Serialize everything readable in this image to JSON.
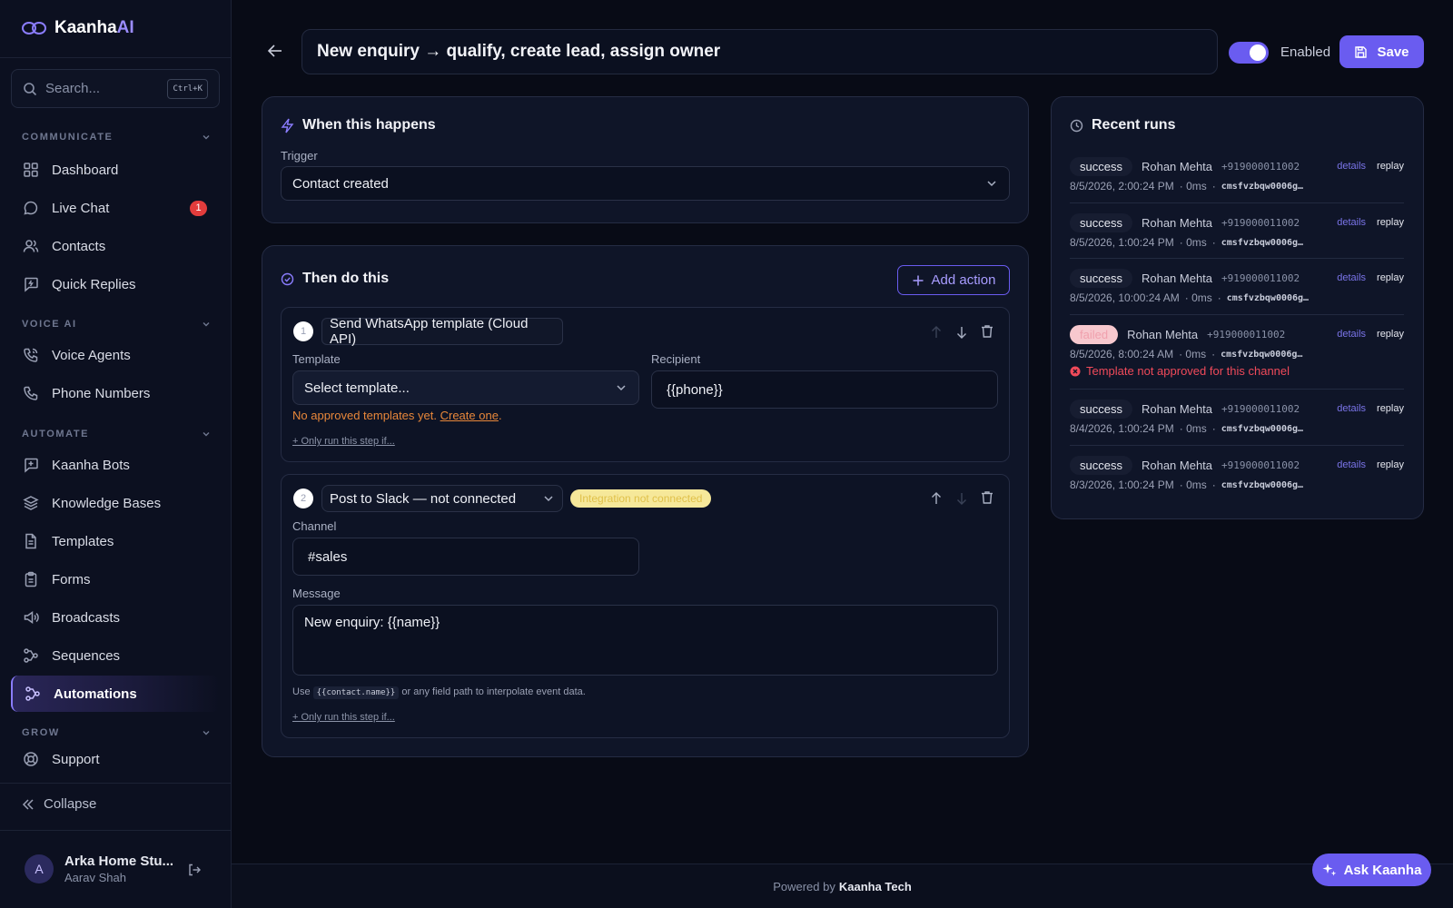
{
  "brand": {
    "name_main": "Kaanha",
    "name_accent": "AI"
  },
  "search": {
    "placeholder": "Search...",
    "shortcut": "Ctrl+K"
  },
  "sidebar": {
    "sections": {
      "communicate": "COMMUNICATE",
      "voice_ai": "VOICE AI",
      "automate": "AUTOMATE",
      "grow": "GROW"
    },
    "items": {
      "dashboard": "Dashboard",
      "live_chat": "Live Chat",
      "live_chat_badge": "1",
      "contacts": "Contacts",
      "quick_replies": "Quick Replies",
      "voice_agents": "Voice Agents",
      "phone_numbers": "Phone Numbers",
      "kaanha_bots": "Kaanha Bots",
      "knowledge_bases": "Knowledge Bases",
      "templates": "Templates",
      "forms": "Forms",
      "broadcasts": "Broadcasts",
      "sequences": "Sequences",
      "automations": "Automations",
      "support": "Support"
    },
    "collapse": "Collapse"
  },
  "user": {
    "avatar_initial": "A",
    "org": "Arka Home Stu...",
    "name": "Aarav Shah"
  },
  "header": {
    "title": "New enquiry → qualify, create lead, assign owner",
    "enabled_label": "Enabled",
    "enabled": true,
    "save_label": "Save"
  },
  "trigger_card": {
    "title": "When this happens",
    "trigger_label": "Trigger",
    "trigger_value": "Contact created"
  },
  "actions_card": {
    "title": "Then do this",
    "add_action": "Add action",
    "step1": {
      "number": "1",
      "name": "Send WhatsApp template (Cloud API)",
      "template_label": "Template",
      "template_value": "Select template...",
      "recipient_label": "Recipient",
      "recipient_value": "{{phone}}",
      "warning_text": "No approved templates yet.",
      "warning_link": "Create one",
      "warning_end": ".",
      "condition": "+ Only run this step if..."
    },
    "step2": {
      "number": "2",
      "name": "Post to Slack — not connected",
      "badge": "Integration not connected",
      "channel_label": "Channel",
      "channel_value": "#sales",
      "message_label": "Message",
      "message_value": "New enquiry: {{name}}",
      "hint_pre": "Use",
      "hint_code": "{{contact.name}}",
      "hint_post": "or any field path to interpolate event data.",
      "condition": "+ Only run this step if..."
    }
  },
  "runs_card": {
    "title": "Recent runs",
    "details_label": "details",
    "replay_label": "replay",
    "runs": [
      {
        "status": "success",
        "name": "Rohan Mehta",
        "phone": "+919000011002",
        "time": "8/5/2026, 2:00:24 PM",
        "duration": "· 0ms",
        "dot": "·",
        "id": "cmsfvzbqw0006g…"
      },
      {
        "status": "success",
        "name": "Rohan Mehta",
        "phone": "+919000011002",
        "time": "8/5/2026, 1:00:24 PM",
        "duration": "· 0ms",
        "dot": "·",
        "id": "cmsfvzbqw0006g…"
      },
      {
        "status": "success",
        "name": "Rohan Mehta",
        "phone": "+919000011002",
        "time": "8/5/2026, 10:00:24 AM",
        "duration": "· 0ms",
        "dot": "·",
        "id": "cmsfvzbqw0006g…"
      },
      {
        "status": "failed",
        "name": "Rohan Mehta",
        "phone": "+919000011002",
        "time": "8/5/2026, 8:00:24 AM",
        "duration": "· 0ms",
        "dot": "·",
        "id": "cmsfvzbqw0006g…",
        "error": "Template not approved for this channel"
      },
      {
        "status": "success",
        "name": "Rohan Mehta",
        "phone": "+919000011002",
        "time": "8/4/2026, 1:00:24 PM",
        "duration": "· 0ms",
        "dot": "·",
        "id": "cmsfvzbqw0006g…"
      },
      {
        "status": "success",
        "name": "Rohan Mehta",
        "phone": "+919000011002",
        "time": "8/3/2026, 1:00:24 PM",
        "duration": "· 0ms",
        "dot": "·",
        "id": "cmsfvzbqw0006g…"
      }
    ]
  },
  "footer": {
    "prefix": "Powered by",
    "brand": "Kaanha Tech"
  },
  "assistant": {
    "label": "Ask Kaanha"
  },
  "colors": {
    "accent": "#6a5cf0",
    "background": "#080b16",
    "error": "#f04a5a",
    "warning": "#e8873a"
  }
}
